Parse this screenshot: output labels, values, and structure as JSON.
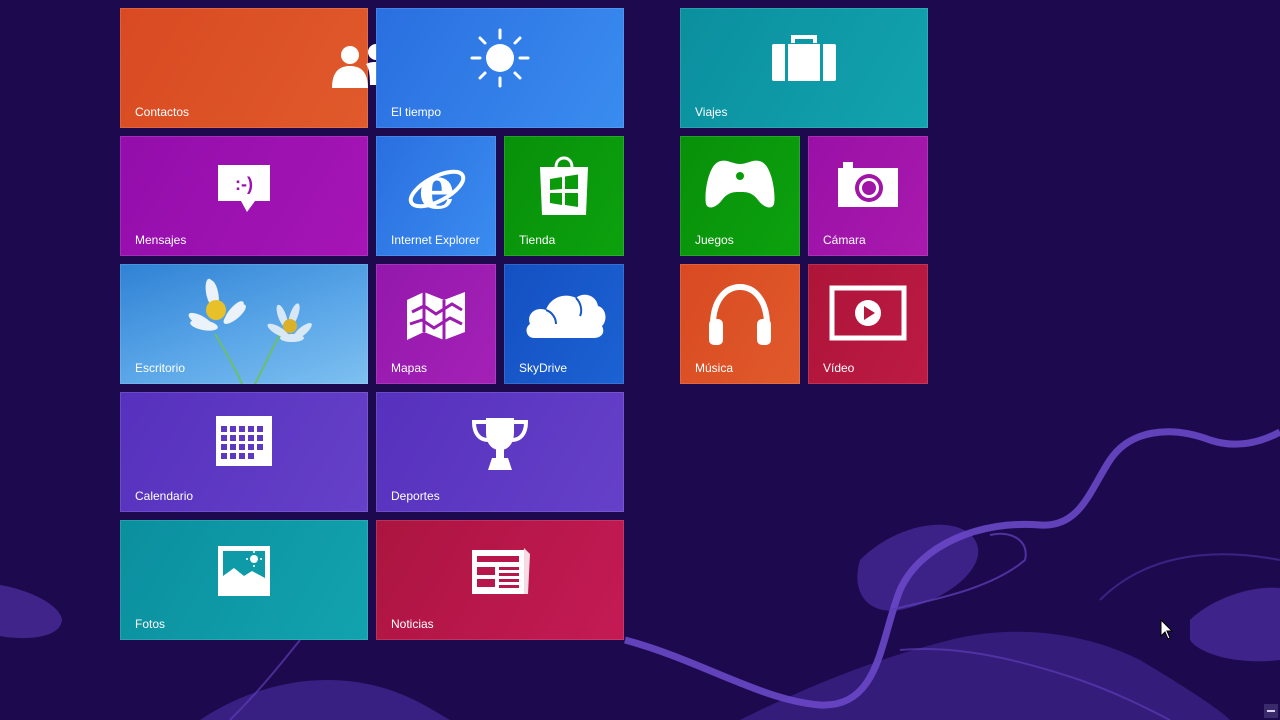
{
  "tiles": {
    "contactos": {
      "label": "Contactos",
      "color": "#dc5426",
      "icon": "people-icon"
    },
    "tiempo": {
      "label": "El tiempo",
      "color": "#2b7fe6",
      "icon": "sun-icon"
    },
    "viajes": {
      "label": "Viajes",
      "color": "#0f9aa7",
      "icon": "suitcase-icon"
    },
    "mensajes": {
      "label": "Mensajes",
      "color": "#9c0fb0",
      "icon": "chat-bubble-icon"
    },
    "ie": {
      "label": "Internet Explorer",
      "color": "#2b7fe6",
      "icon": "internet-explorer-icon"
    },
    "tienda": {
      "label": "Tienda",
      "color": "#0a9b0a",
      "icon": "shopping-bag-icon"
    },
    "juegos": {
      "label": "Juegos",
      "color": "#0a9b0a",
      "icon": "game-controller-icon"
    },
    "camara": {
      "label": "Cámara",
      "color": "#a114a8",
      "icon": "camera-icon"
    },
    "escritorio": {
      "label": "Escritorio",
      "color": "#3f8fd8",
      "icon": "daisy-wallpaper"
    },
    "mapas": {
      "label": "Mapas",
      "color": "#9c1cb0",
      "icon": "map-icon"
    },
    "skydrive": {
      "label": "SkyDrive",
      "color": "#1857c8",
      "icon": "cloud-icon"
    },
    "musica": {
      "label": "Música",
      "color": "#dc5426",
      "icon": "headphones-icon"
    },
    "video": {
      "label": "Vídeo",
      "color": "#b5173e",
      "icon": "play-icon"
    },
    "calendario": {
      "label": "Calendario",
      "color": "#5d38c2",
      "icon": "calendar-icon"
    },
    "deportes": {
      "label": "Deportes",
      "color": "#5d38c2",
      "icon": "trophy-icon"
    },
    "fotos": {
      "label": "Fotos",
      "color": "#0f9aa7",
      "icon": "picture-icon"
    },
    "noticias": {
      "label": "Noticias",
      "color": "#b8174b",
      "icon": "newspaper-icon"
    }
  }
}
